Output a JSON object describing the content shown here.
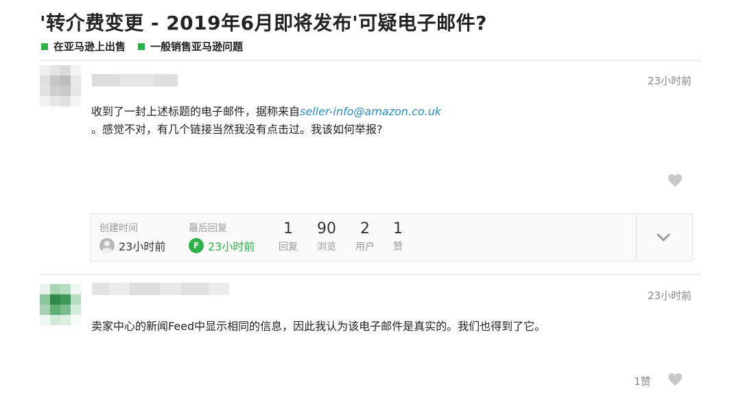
{
  "thread": {
    "title": "'转介费变更 - 2019年6月即将发布'可疑电子邮件?",
    "categories": [
      "在亚马逊上出售",
      "一般销售亚马逊问题"
    ]
  },
  "post1": {
    "time": "23小时前",
    "text_before": "收到了一封上述标题的电子邮件，据称来自",
    "email": "seller-info@amazon.co.uk",
    "text_after": "。感觉不对，有几个链接当然我没有点击过。我该如何举报?"
  },
  "stats": {
    "created_label": "创建时间",
    "created_time": "23小时前",
    "last_reply_label": "最后回复",
    "last_reply_time": "23小时前",
    "items": [
      {
        "value": "1",
        "label": "回复"
      },
      {
        "value": "90",
        "label": "浏览"
      },
      {
        "value": "2",
        "label": "用户"
      },
      {
        "value": "1",
        "label": "赞"
      }
    ]
  },
  "post2": {
    "time": "23小时前",
    "text": "卖家中心的新闻Feed中显示相同的信息，因此我认为该电子邮件是真实的。我们也得到了它。",
    "likes": "1赞"
  },
  "colors": {
    "accent_green": "#2eb04b",
    "link_blue": "#2c8bb7",
    "muted": "#888888"
  },
  "icons": [
    "heart-icon",
    "chevron-down-icon",
    "user-avatar-icon",
    "category-square-icon"
  ]
}
